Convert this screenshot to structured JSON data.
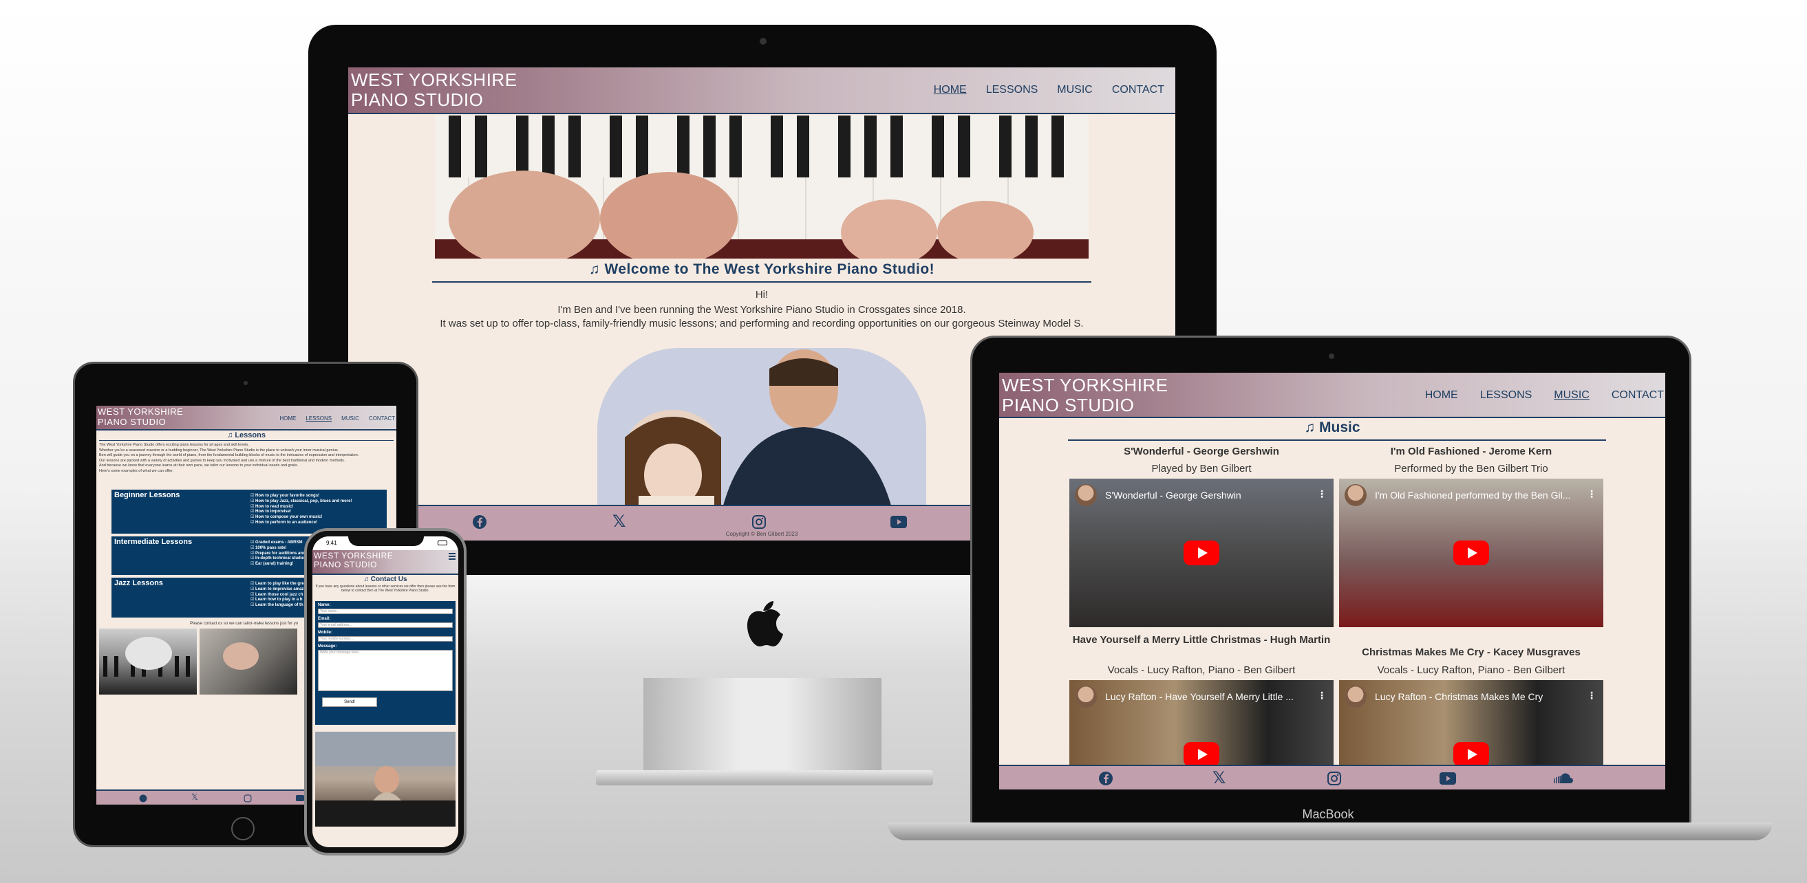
{
  "site": {
    "logo_line1": "WEST YORKSHIRE",
    "logo_line2": "PIANO STUDIO",
    "nav": [
      "HOME",
      "LESSONS",
      "MUSIC",
      "CONTACT"
    ],
    "copyright": "Copyright © Ben Gilbert 2023"
  },
  "home": {
    "heading": "Welcome to The West Yorkshire Piano Studio!",
    "para1": "Hi!",
    "para2": "I'm Ben and I've been running the West Yorkshire Piano Studio in Crossgates since 2018.",
    "para3": "It was set up to offer top-class, family-friendly music lessons; and performing and recording opportunities on our gorgeous Steinway Model S."
  },
  "music": {
    "heading": "Music",
    "videos": [
      {
        "title": "S'Wonderful - George Gershwin",
        "credit": "Played by Ben Gilbert",
        "overlay": "S'Wonderful - George Gershwin"
      },
      {
        "title": "I'm Old Fashioned - Jerome Kern",
        "credit": "Performed by the Ben Gilbert Trio",
        "overlay": "I'm Old Fashioned performed by the Ben Gil..."
      },
      {
        "title": "Have Yourself a Merry Little Christmas - Hugh Martin",
        "credit": "Vocals - Lucy Rafton, Piano - Ben Gilbert",
        "overlay": "Lucy Rafton - Have Yourself A Merry Little ..."
      },
      {
        "title": "Christmas Makes Me Cry - Kacey Musgraves",
        "credit": "Vocals - Lucy Rafton, Piano - Ben Gilbert",
        "overlay": "Lucy Rafton - Christmas Makes Me Cry"
      }
    ]
  },
  "lessons": {
    "heading": "Lessons",
    "intro": [
      "The West Yorkshire Piano Studio offers exciting piano lessons for all ages and skill levels.",
      "Whether you're a seasoned maestro or a budding beginner, The West Yorkshire Piano Studio is the place to unleash your inner musical genius.",
      "Ben will guide you on a journey through the world of piano, from the fundamental building blocks of music to the intricacies of expression and interpretation.",
      "Our lessons are packed with a variety of activities and games to keep you motivated and use a mixture of the best traditional and modern methods.",
      "And because we know that everyone learns at their own pace, we tailor our lessons to your individual needs and goals.",
      "Here's some examples of what we can offer:"
    ],
    "cards": [
      {
        "title": "Beginner Lessons",
        "items": [
          "How to play your favorite songs!",
          "How to play Jazz, classical, pop, blues and more!",
          "How to read music!",
          "How to improvise!",
          "How to compose your own music!",
          "How to perform to an audience!"
        ]
      },
      {
        "title": "Intermediate Lessons",
        "items": [
          "Graded exams - ABRSM",
          "100% pass rate!",
          "Prepare for auditions and",
          "In-depth technical studies",
          "Ear (aural) training!"
        ]
      },
      {
        "title": "Jazz Lessons",
        "items": [
          "Learn to play like the gre",
          "Learn to improvise amaz",
          "Learn those cool jazz ch",
          "Learn how to play in a b",
          "Learn the language of th"
        ]
      }
    ],
    "contact_note": "Please contact us so we can tailor-make lessons just for yo"
  },
  "contact": {
    "heading": "Contact Us",
    "intro": "If you have any questions about lessons or other services we offer then please use the form below to contact Ben at The West Yorkshire Piano Studio.",
    "fields": [
      {
        "label": "Name:",
        "placeholder": "Your name..."
      },
      {
        "label": "Email:",
        "placeholder": "Your email address..."
      },
      {
        "label": "Mobile:",
        "placeholder": "Your mobile number..."
      },
      {
        "label": "Message:",
        "placeholder": "Write your message here..."
      }
    ],
    "send": "Send!"
  },
  "devices": {
    "macbook_label": "MacBook",
    "phone_time": "9:41"
  },
  "colors": {
    "navy": "#1f3f63",
    "cream": "#f6ebe2",
    "mauve": "#c29fac",
    "lesson_blue": "#073b66"
  },
  "icons": [
    "music-note-icon",
    "facebook-icon",
    "x-icon",
    "instagram-icon",
    "youtube-icon",
    "soundcloud-icon",
    "apple-logo-icon",
    "hamburger-icon"
  ]
}
